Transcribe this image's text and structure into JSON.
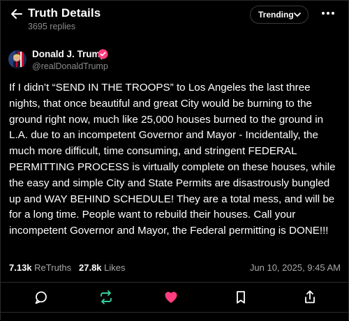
{
  "header": {
    "title": "Truth Details",
    "replies": "3695 replies",
    "sort_label": "Trending"
  },
  "author": {
    "name": "Donald J. Trump",
    "handle": "@realDonaldTrump"
  },
  "post": {
    "text": "If I didn’t “SEND IN THE TROOPS” to Los Angeles the last three nights, that once beautiful and great City would be burning to the ground right now, much like 25,000 houses burned to the ground in L.A. due to an incompetent Governor and Mayor - Incidentally, the much more difficult, time consuming, and stringent FEDERAL PERMITTING PROCESS is virtually complete on these houses, while the easy and simple City and State Permits are disastrously bungled up and WAY BEHIND SCHEDULE! They are a total mess, and will be for a long time. People want to rebuild their houses. Call your incompetent Governor and Mayor, the Federal permitting is DONE!!!"
  },
  "stats": {
    "retruths_count": "7.13k",
    "retruths_label": "ReTruths",
    "likes_count": "27.8k",
    "likes_label": "Likes",
    "timestamp": "Jun 10, 2025, 9:45 AM"
  },
  "colors": {
    "accent": "#ff3d7f",
    "retruth": "#35d0a0",
    "muted": "#8b8b8b",
    "verified": "#ff3d7f"
  },
  "icons": [
    "back-arrow-icon",
    "chevron-down-icon",
    "more-icon",
    "verified-icon",
    "reply-icon",
    "retruth-icon",
    "like-icon",
    "bookmark-icon",
    "share-icon"
  ]
}
